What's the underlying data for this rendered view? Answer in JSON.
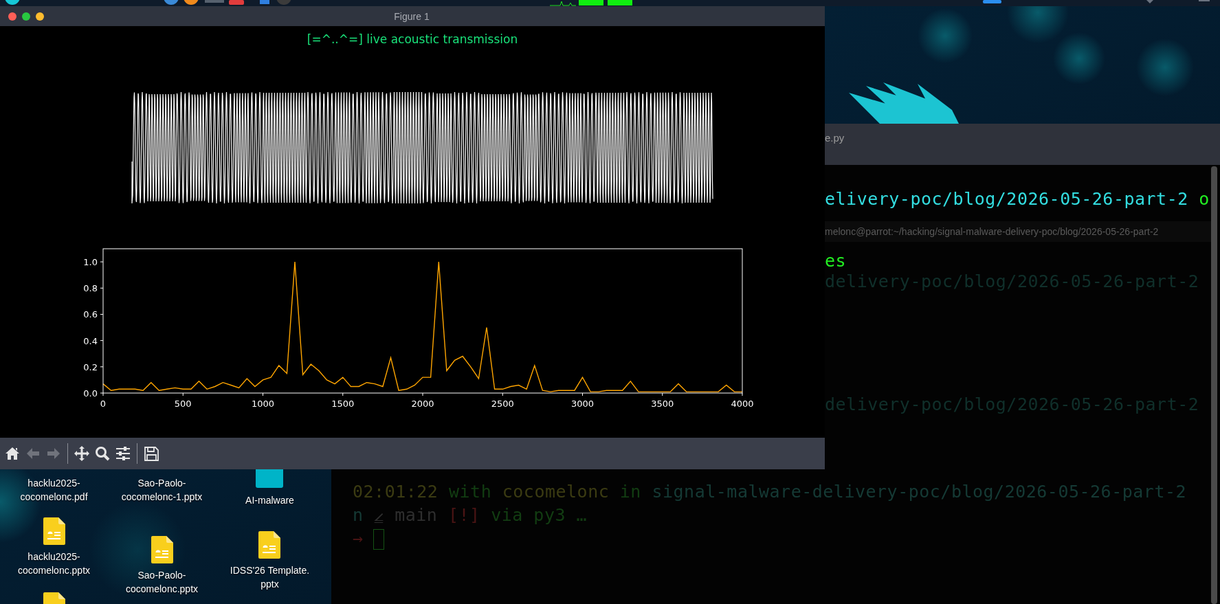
{
  "figure_window": {
    "title": "Figure 1",
    "plot_title": "[=^..^=] live acoustic transmission",
    "spectrum": {
      "chart_data": {
        "type": "line",
        "xlim": [
          0,
          4000
        ],
        "ylim": [
          0,
          1.1
        ],
        "xticks": [
          0,
          500,
          1000,
          1500,
          2000,
          2500,
          3000,
          3500,
          4000
        ],
        "yticks": [
          {
            "value": 0,
            "label": "0.0"
          },
          {
            "value": 0.2,
            "label": "0.2"
          },
          {
            "value": 0.4,
            "label": "0.4"
          },
          {
            "value": 0.6,
            "label": "0.6"
          },
          {
            "value": 0.8,
            "label": "0.8"
          },
          {
            "value": 1,
            "label": "1.0"
          }
        ],
        "x": [
          0,
          50,
          100,
          150,
          200,
          250,
          300,
          350,
          400,
          450,
          500,
          550,
          600,
          650,
          700,
          750,
          800,
          850,
          900,
          950,
          1000,
          1050,
          1100,
          1150,
          1200,
          1250,
          1300,
          1350,
          1400,
          1450,
          1500,
          1550,
          1600,
          1650,
          1700,
          1750,
          1800,
          1850,
          1900,
          1950,
          2000,
          2050,
          2100,
          2150,
          2200,
          2250,
          2300,
          2350,
          2400,
          2450,
          2500,
          2550,
          2600,
          2650,
          2700,
          2750,
          2800,
          2850,
          2900,
          2950,
          3000,
          3050,
          3100,
          3150,
          3200,
          3250,
          3300,
          3350,
          3400,
          3450,
          3500,
          3550,
          3600,
          3650,
          3700,
          3750,
          3800,
          3850,
          3900,
          3950,
          4000
        ],
        "series": [
          {
            "color": "#ffa500",
            "values": [
              0.07,
              0.02,
              0.03,
              0.03,
              0.03,
              0.02,
              0.08,
              0.02,
              0.03,
              0.04,
              0.03,
              0.03,
              0.09,
              0.03,
              0.05,
              0.08,
              0.06,
              0.04,
              0.11,
              0.05,
              0.1,
              0.12,
              0.21,
              0.15,
              1.0,
              0.14,
              0.22,
              0.17,
              0.1,
              0.07,
              0.12,
              0.05,
              0.05,
              0.08,
              0.07,
              0.05,
              0.27,
              0.02,
              0.03,
              0.06,
              0.12,
              0.12,
              1.0,
              0.17,
              0.25,
              0.28,
              0.2,
              0.11,
              0.5,
              0.03,
              0.03,
              0.05,
              0.06,
              0.03,
              0.21,
              0.02,
              0.01,
              0.02,
              0.02,
              0.02,
              0.12,
              0.01,
              0.01,
              0.02,
              0.02,
              0.02,
              0.09,
              0.01,
              0.01,
              0.01,
              0.01,
              0.01,
              0.07,
              0.01,
              0.01,
              0.01,
              0.01,
              0.01,
              0.06,
              0.01,
              0.01
            ]
          }
        ]
      }
    },
    "toolbar": [
      {
        "kind": "home",
        "disabled": false
      },
      {
        "kind": "back",
        "disabled": true
      },
      {
        "kind": "forward",
        "disabled": true
      },
      {
        "kind": "separator"
      },
      {
        "kind": "pan",
        "disabled": false
      },
      {
        "kind": "zoom",
        "disabled": false
      },
      {
        "kind": "configure",
        "disabled": false
      },
      {
        "kind": "separator"
      },
      {
        "kind": "save",
        "disabled": false
      }
    ]
  },
  "terminal": {
    "tab_title": "e.py",
    "lines": [
      {
        "kind": "upper",
        "segments": [
          {
            "text": "elivery-poc/blog/2026-05-26-part-2 ",
            "color": "#33dde0"
          },
          {
            "text": "o",
            "color": "#22ee22"
          }
        ]
      },
      {
        "kind": "pane_title",
        "segments": [
          {
            "text": "melonc@parrot:~/hacking/signal-malware-delivery-poc/blog/2026-05-26-part-2",
            "color": "#5a5a5a"
          }
        ]
      },
      {
        "kind": "upper",
        "segments": [
          {
            "text": "es",
            "color": "#22ee22"
          }
        ]
      },
      {
        "kind": "upper",
        "segments": [
          {
            "text": "delivery-poc/blog/2026-05-26-part-2",
            "color": "#10302b"
          }
        ]
      },
      {
        "kind": "upper",
        "segments": [
          {
            "text": "delivery-poc/blog/2026-05-26-part-2",
            "color": "#10302b"
          }
        ]
      },
      {
        "kind": "lower",
        "segments": [
          {
            "text": "02:01:22",
            "color": "#3b3b12"
          },
          {
            "text": " with ",
            "color": "#123d12"
          },
          {
            "text": "cocomelonc",
            "color": "#3b3b12"
          },
          {
            "text": " in ",
            "color": "#123d12"
          },
          {
            "text": "signal-malware-delivery-poc/blog/2026-05-26-part-2",
            "color": "#153a35"
          }
        ]
      },
      {
        "kind": "lower",
        "segments": [
          {
            "text": "n ",
            "color": "#153a35"
          },
          {
            "text": "⦤ main ",
            "color": "#2e2e2e"
          },
          {
            "text": "[!]",
            "color": "#4a1414"
          },
          {
            "text": " via py3 …",
            "color": "#123d12"
          }
        ]
      },
      {
        "kind": "lower",
        "cursor": true,
        "segments": [
          {
            "text": "→",
            "color": "#4a1414"
          }
        ]
      }
    ]
  },
  "desktop": {
    "columns": [
      [
        {
          "label": "hacklu2025-\ncocomelonc.pdf"
        },
        {
          "kind": "pptx",
          "label": "hacklu2025-\ncocomelonc.pptx"
        },
        {
          "kind": "pptx"
        }
      ],
      [
        {
          "label": "Sao-Paolo-\ncocomelonc-1.pptx"
        },
        {
          "kind": "pptx",
          "label": "Sao-Paolo-\ncocomelonc.pptx"
        }
      ],
      [
        {
          "kind": "folder",
          "label": "AI-malware"
        },
        {
          "kind": "pptx",
          "label": "IDSS'26 Template.\npptx"
        }
      ]
    ]
  }
}
